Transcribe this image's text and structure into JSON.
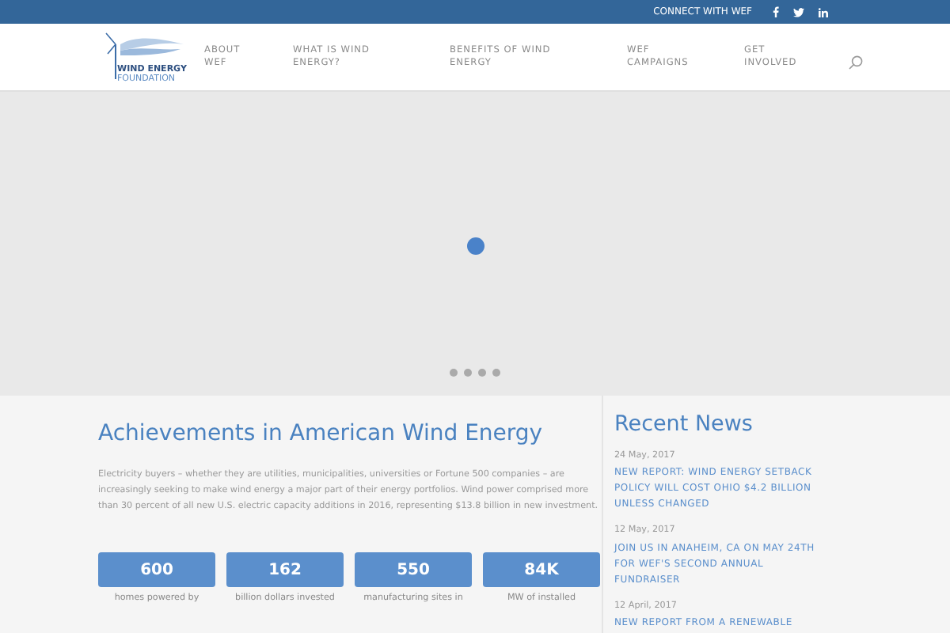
{
  "top_bar": {
    "connect_label": "CONNECT WITH WEF"
  },
  "logo": {
    "line_1": "WIND ENERGY",
    "line_2": "FOUNDATION"
  },
  "nav": [
    {
      "line_1": "ABOUT",
      "line_2": "WEF"
    },
    {
      "line_1": "WHAT IS WIND",
      "line_2": "ENERGY?"
    },
    {
      "line_1": "BENEFITS OF WIND",
      "line_2": "ENERGY"
    },
    {
      "line_1": "WEF",
      "line_2": "CAMPAIGNS"
    },
    {
      "line_1": "GET",
      "line_2": "INVOLVED"
    }
  ],
  "slider": {
    "dots": [
      {
        "selected": false
      },
      {
        "selected": false
      },
      {
        "selected": false
      },
      {
        "selected": false
      }
    ]
  },
  "achievements": {
    "title": "Achievements in American Wind Energy",
    "body": "Electricity buyers – whether they are utilities, municipalities, universities or Fortune 500 companies – are increasingly seeking to make wind energy a major part of their energy portfolios. Wind power comprised more than 30 percent of all new U.S. electric capacity additions in 2016, representing $13.8 billion in new investment.",
    "stats": [
      {
        "value": "600",
        "caption": "homes powered by"
      },
      {
        "value": "162",
        "caption": "billion dollars invested"
      },
      {
        "value": "550",
        "caption": "manufacturing sites in"
      },
      {
        "value": "84K",
        "caption": "MW of installed"
      }
    ]
  },
  "recent_news": {
    "title": "Recent News",
    "items": [
      {
        "date": "24 May, 2017",
        "headline": "NEW REPORT: WIND ENERGY SETBACK POLICY WILL COST OHIO $4.2 BILLION UNLESS CHANGED"
      },
      {
        "date": "12 May, 2017",
        "headline": "JOIN US IN ANAHEIM, CA ON MAY 24TH FOR WEF'S SECOND ANNUAL FUNDRAISER"
      },
      {
        "date": "12 April, 2017",
        "headline": "NEW REPORT FROM A RENEWABLE"
      }
    ]
  }
}
